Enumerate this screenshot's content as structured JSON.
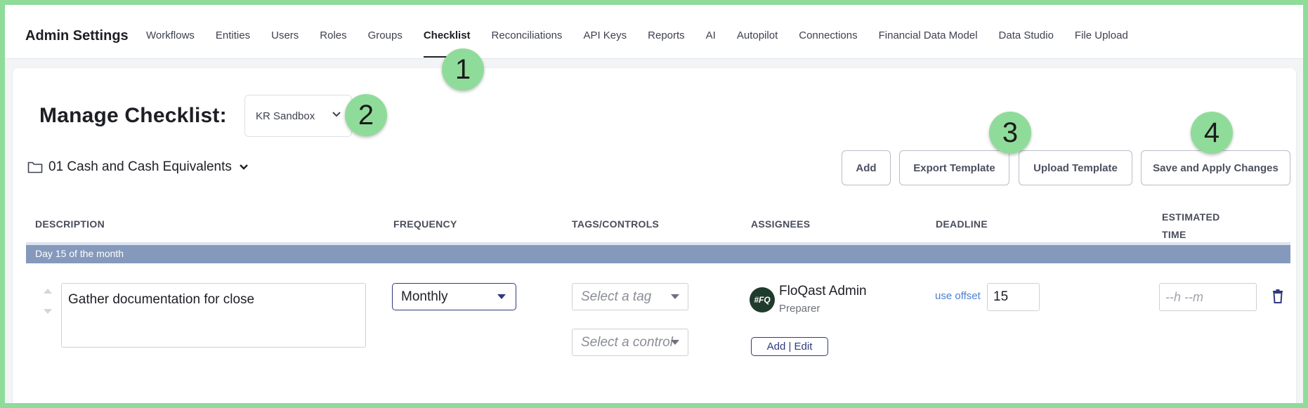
{
  "header": {
    "title": "Admin Settings",
    "tabs": [
      {
        "label": "Workflows",
        "active": false
      },
      {
        "label": "Entities",
        "active": false
      },
      {
        "label": "Users",
        "active": false
      },
      {
        "label": "Roles",
        "active": false
      },
      {
        "label": "Groups",
        "active": false
      },
      {
        "label": "Checklist",
        "active": true
      },
      {
        "label": "Reconciliations",
        "active": false
      },
      {
        "label": "API Keys",
        "active": false
      },
      {
        "label": "Reports",
        "active": false
      },
      {
        "label": "AI",
        "active": false
      },
      {
        "label": "Autopilot",
        "active": false
      },
      {
        "label": "Connections",
        "active": false
      },
      {
        "label": "Financial Data Model",
        "active": false
      },
      {
        "label": "Data Studio",
        "active": false
      },
      {
        "label": "File Upload",
        "active": false
      }
    ]
  },
  "manage": {
    "title": "Manage Checklist:",
    "entity_selected": "KR Sandbox"
  },
  "folder": {
    "name": "01 Cash and Cash Equivalents"
  },
  "toolbar": {
    "add_label": "Add",
    "export_label": "Export Template",
    "upload_label": "Upload Template",
    "save_label": "Save and Apply Changes"
  },
  "markers": [
    "1",
    "2",
    "3",
    "4"
  ],
  "table": {
    "headers": {
      "description": "DESCRIPTION",
      "frequency": "FREQUENCY",
      "tags": "TAGS/CONTROLS",
      "assignees": "ASSIGNEES",
      "deadline": "DEADLINE",
      "estimated_line1": "ESTIMATED",
      "estimated_line2": "TIME"
    },
    "group_label": "Day 15 of the month",
    "row": {
      "description": "Gather documentation for close",
      "frequency": "Monthly",
      "tag_placeholder": "Select a tag",
      "control_placeholder": "Select a control",
      "avatar_text": "#FQ",
      "assignee_name": "FloQast Admin",
      "assignee_role": "Preparer",
      "add_edit_label": "Add | Edit",
      "use_offset_label": "use offset",
      "deadline_value": "15",
      "estimated_placeholder": "--h --m"
    }
  },
  "colors": {
    "marker": "#8fdc9a",
    "group_bar": "#8499bb",
    "accent_navy": "#2f3a7a",
    "link_blue": "#4d7fd1"
  }
}
